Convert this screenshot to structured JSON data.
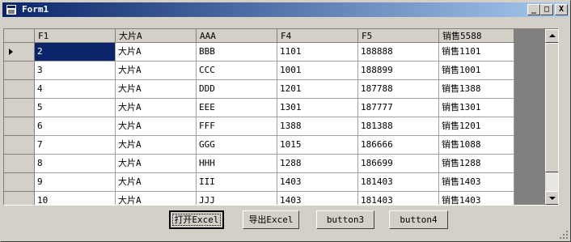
{
  "window": {
    "title": "Form1"
  },
  "titlebar_buttons": {
    "minimize": "_",
    "maximize": "□",
    "close": "X"
  },
  "grid": {
    "columns": [
      "F1",
      "大片A",
      "AAA",
      "F4",
      "F5",
      "销售5588"
    ],
    "rows": [
      [
        "2",
        "大片A",
        "BBB",
        "1101",
        "188888",
        "销售1101"
      ],
      [
        "3",
        "大片A",
        "CCC",
        "1001",
        "188899",
        "销售1001"
      ],
      [
        "4",
        "大片A",
        "DDD",
        "1201",
        "187788",
        "销售1388"
      ],
      [
        "5",
        "大片A",
        "EEE",
        "1301",
        "187777",
        "销售1301"
      ],
      [
        "6",
        "大片A",
        "FFF",
        "1388",
        "181388",
        "销售1201"
      ],
      [
        "7",
        "大片A",
        "GGG",
        "1015",
        "186666",
        "销售1088"
      ],
      [
        "8",
        "大片A",
        "HHH",
        "1288",
        "186699",
        "销售1288"
      ],
      [
        "9",
        "大片A",
        "III",
        "1403",
        "181403",
        "销售1403"
      ],
      [
        "10",
        "大片A",
        "JJJ",
        "1403",
        "181403",
        "销售1403"
      ]
    ],
    "current_row": 0
  },
  "buttons": [
    "打开Excel",
    "导出Excel",
    "button3",
    "button4"
  ],
  "colors": {
    "titlebar_start": "#0a246a",
    "titlebar_end": "#a6caf0",
    "selection": "#0a246a",
    "face": "#d4d0c8"
  }
}
